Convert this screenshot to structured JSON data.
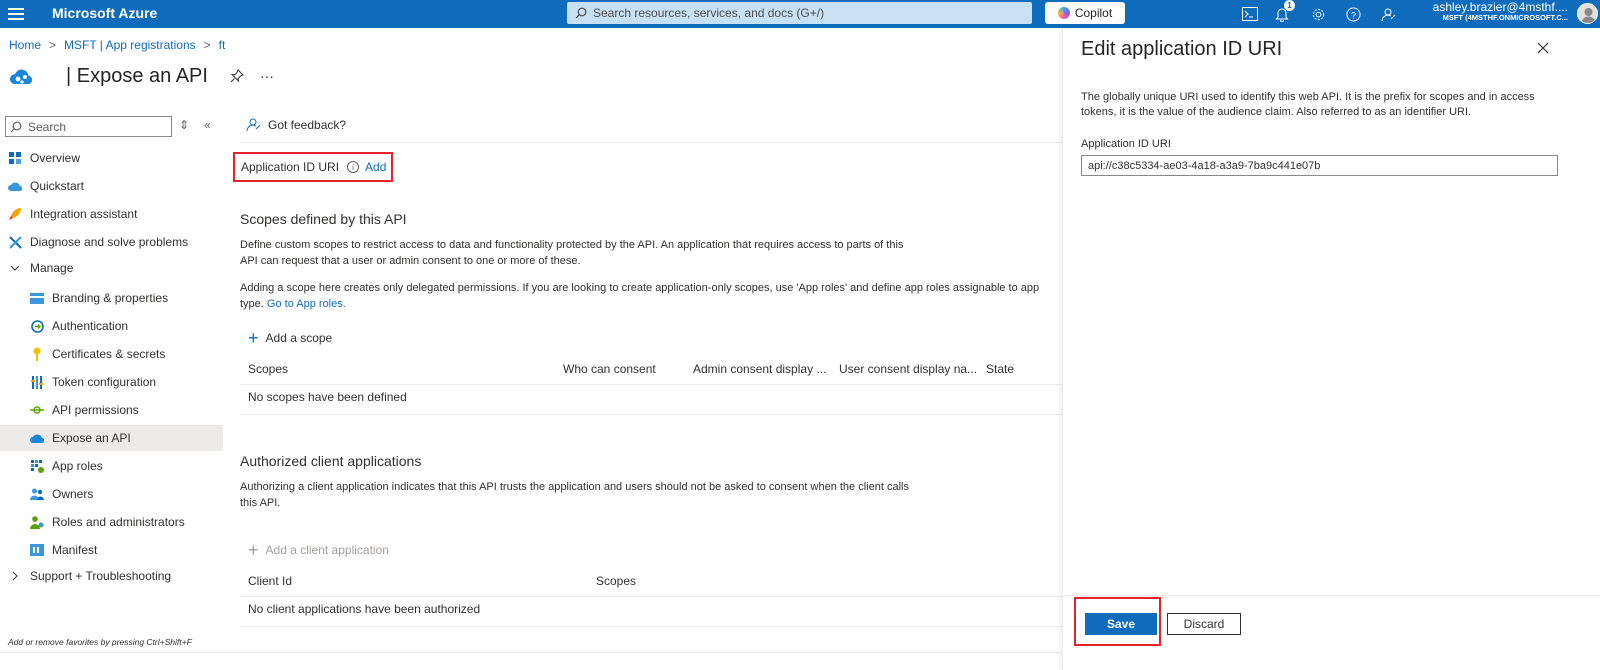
{
  "topbar": {
    "brand": "Microsoft Azure",
    "search_placeholder": "Search resources, services, and docs (G+/)",
    "copilot_label": "Copilot",
    "notification_count": "1",
    "account_name": "ashley.brazier@4msthf....",
    "account_tenant": "MSFT (4MSTHF.ONMICROSOFT.C...",
    "icons": [
      "hamburger-icon",
      "cloud-shell-icon",
      "bell-icon",
      "gear-icon",
      "help-icon",
      "feedback-icon"
    ],
    "bg_color": "#0f6cbd"
  },
  "breadcrumb": [
    "Home",
    "MSFT | App registrations",
    "ft"
  ],
  "page": {
    "title": "| Expose an API"
  },
  "nav": {
    "search_placeholder": "Search",
    "items": [
      {
        "label": "Overview",
        "icon": "overview-icon"
      },
      {
        "label": "Quickstart",
        "icon": "quickstart-icon"
      },
      {
        "label": "Integration assistant",
        "icon": "rocket-icon"
      },
      {
        "label": "Diagnose and solve problems",
        "icon": "wrench-icon"
      },
      {
        "label": "Manage",
        "icon": "chevron-down-icon"
      },
      {
        "label": "Branding & properties",
        "icon": "branding-icon"
      },
      {
        "label": "Authentication",
        "icon": "authentication-icon"
      },
      {
        "label": "Certificates & secrets",
        "icon": "key-icon"
      },
      {
        "label": "Token configuration",
        "icon": "token-icon"
      },
      {
        "label": "API permissions",
        "icon": "api-permissions-icon"
      },
      {
        "label": "Expose an API",
        "icon": "cloud-icon"
      },
      {
        "label": "App roles",
        "icon": "app-roles-icon"
      },
      {
        "label": "Owners",
        "icon": "owners-icon"
      },
      {
        "label": "Roles and administrators",
        "icon": "roles-icon"
      },
      {
        "label": "Manifest",
        "icon": "manifest-icon"
      },
      {
        "label": "Support + Troubleshooting",
        "icon": "chevron-right-icon"
      }
    ],
    "footer": "Add or remove favorites by pressing Ctrl+Shift+F"
  },
  "main": {
    "feedback": "Got feedback?",
    "app_id_uri_label": "Application ID URI",
    "app_id_uri_add": "Add",
    "scopes_heading": "Scopes defined by this API",
    "scopes_desc1": "Define custom scopes to restrict access to data and functionality protected by the API. An application that requires access to parts of this",
    "scopes_desc2": "API can request that a user or admin consent to one or more of these.",
    "scopes_note1": "Adding a scope here creates only delegated permissions. If you are looking to create application-only scopes, use 'App roles' and define app roles assignable to app",
    "scopes_note2": "type.",
    "scopes_note_link": "Go to App roles.",
    "add_scope": "Add a scope",
    "scopes_columns": [
      "Scopes",
      "Who can consent",
      "Admin consent display ...",
      "User consent display na...",
      "State"
    ],
    "scopes_empty": "No scopes have been defined",
    "clients_heading": "Authorized client applications",
    "clients_desc1": "Authorizing a client application indicates that this API trusts the application and users should not be asked to consent when the client calls",
    "clients_desc2": "this API.",
    "add_client": "Add a client application",
    "clients_columns": [
      "Client Id",
      "Scopes"
    ],
    "clients_empty": "No client applications have been authorized"
  },
  "panel": {
    "title": "Edit application ID URI",
    "description": "The globally unique URI used to identify this web API. It is the prefix for scopes and in access tokens, it is the value of the audience claim. Also referred to as an identifier URI.",
    "field_label": "Application ID URI",
    "field_value": "api://c38c5334-ae03-4a18-a3a9-7ba9c441e07b",
    "save": "Save",
    "discard": "Discard",
    "highlight_color": "#e3242b"
  }
}
